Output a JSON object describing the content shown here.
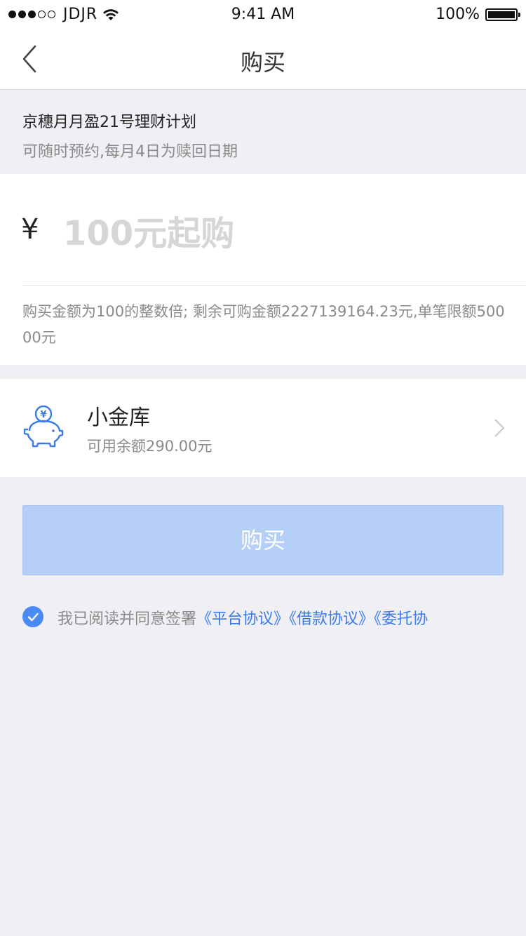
{
  "status_bar": {
    "carrier": "JDJR",
    "time": "9:41 AM",
    "battery": "100%",
    "signal_bars_filled": 3,
    "signal_bars_total": 5
  },
  "nav": {
    "title": "购买",
    "back_icon": "chevron-left-icon"
  },
  "product": {
    "name": "京穗月月盈21号理财计划",
    "description": "可随时预约,每月4日为赎回日期"
  },
  "amount": {
    "currency_symbol": "¥",
    "placeholder": "100元起购",
    "value": "",
    "hint": "购买金额为100的整数倍; 剩余可购金额2227139164.23元,单笔限额50000元"
  },
  "wallet": {
    "icon": "piggy-bank-icon",
    "title": "小金库",
    "balance": "可用余额290.00元"
  },
  "buy_button": {
    "label": "购买",
    "enabled": false
  },
  "agreement": {
    "checked": true,
    "text": "我已阅读并同意签署",
    "links": [
      "《平台协议》",
      "《借款协议》",
      "《委托协"
    ]
  },
  "colors": {
    "accent": "#4a8af4",
    "link": "#3b7be8",
    "button_disabled": "#b6cff7",
    "background": "#efeff4"
  }
}
